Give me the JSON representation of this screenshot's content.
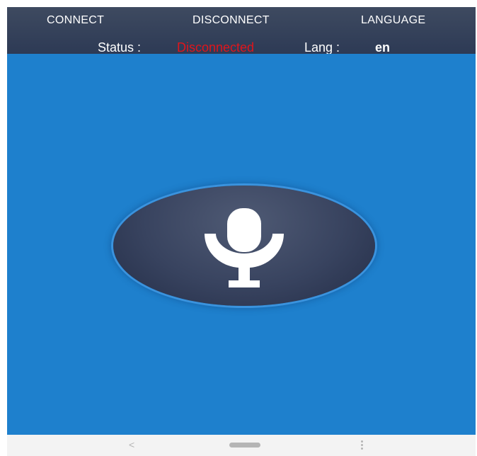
{
  "menu": {
    "connect_label": "CONNECT",
    "disconnect_label": "DISCONNECT",
    "language_label": "LANGUAGE"
  },
  "status": {
    "label": "Status :",
    "value": "Disconnected",
    "value_color": "#e0151b",
    "lang_label": "Lang :",
    "lang_value": "en"
  },
  "mic": {
    "icon": "microphone-icon"
  },
  "navbar": {
    "back_glyph": "<",
    "home_icon": "home-pill-icon",
    "menu_icon": "menu-dots-icon"
  },
  "colors": {
    "topbar": "#2d3a55",
    "main_background": "#1e80cd",
    "mic_button": "#38435f",
    "status_disconnected": "#e0151b"
  }
}
